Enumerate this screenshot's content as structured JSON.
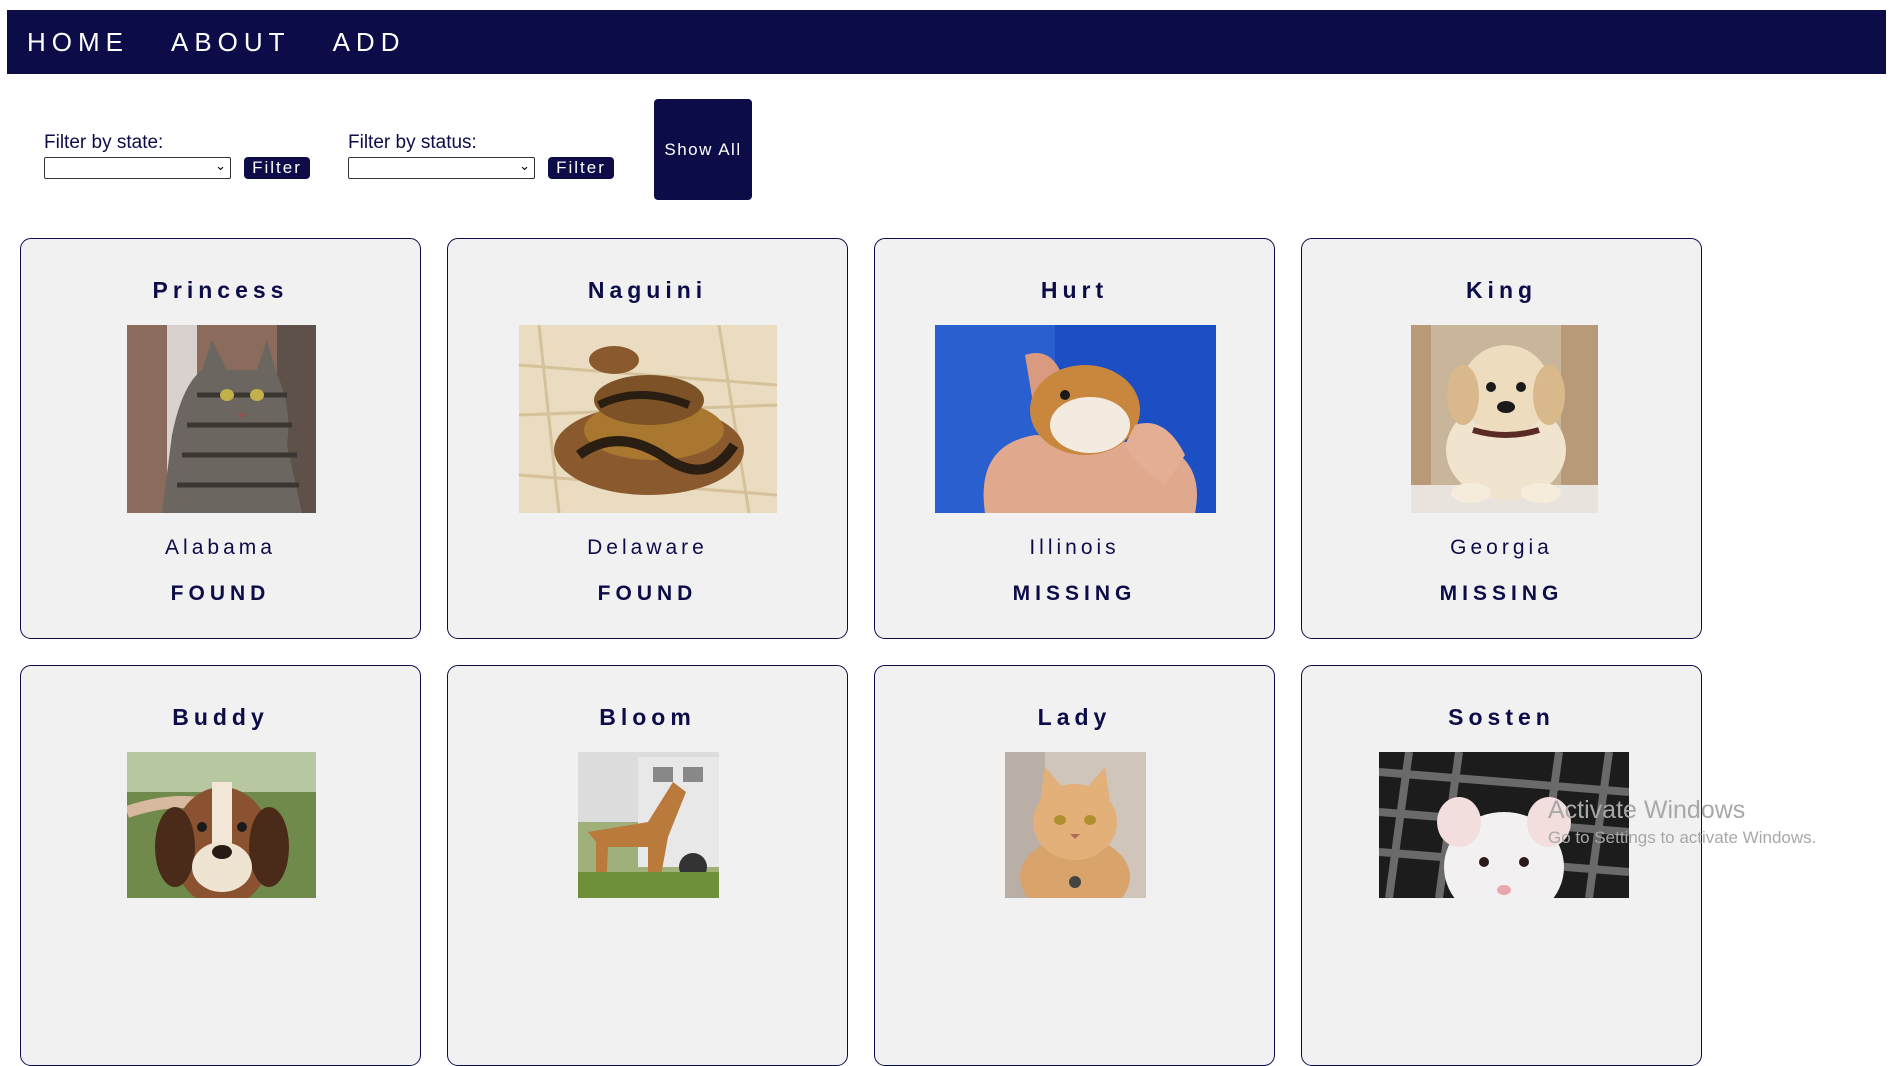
{
  "nav": {
    "items": [
      {
        "label": "HOME"
      },
      {
        "label": "ABOUT"
      },
      {
        "label": "ADD"
      }
    ]
  },
  "filters": {
    "state": {
      "label": "Filter by state:",
      "selected": "",
      "button": "Filter"
    },
    "status": {
      "label": "Filter by status:",
      "selected": "",
      "button": "Filter"
    },
    "show_all": "Show All"
  },
  "pets": [
    {
      "name": "Princess",
      "state": "Alabama",
      "status": "FOUND",
      "photo": "tabby-cat"
    },
    {
      "name": "Naguini",
      "state": "Delaware",
      "status": "FOUND",
      "photo": "ball-python-snake"
    },
    {
      "name": "Hurt",
      "state": "Illinois",
      "status": "MISSING",
      "photo": "hamster-in-hands"
    },
    {
      "name": "King",
      "state": "Georgia",
      "status": "MISSING",
      "photo": "golden-retriever-puppy"
    },
    {
      "name": "Buddy",
      "state": "",
      "status": "",
      "photo": "beagle-hound-dog"
    },
    {
      "name": "Bloom",
      "state": "",
      "status": "",
      "photo": "palomino-horse"
    },
    {
      "name": "Lady",
      "state": "",
      "status": "",
      "photo": "orange-cat"
    },
    {
      "name": "Sosten",
      "state": "",
      "status": "",
      "photo": "white-rat"
    }
  ],
  "watermark": {
    "title": "Activate Windows",
    "subtitle": "Go to Settings to activate Windows."
  },
  "colors": {
    "primary": "#0c0c48",
    "card_bg": "#f1f1f1",
    "page_bg": "#ffffff"
  }
}
